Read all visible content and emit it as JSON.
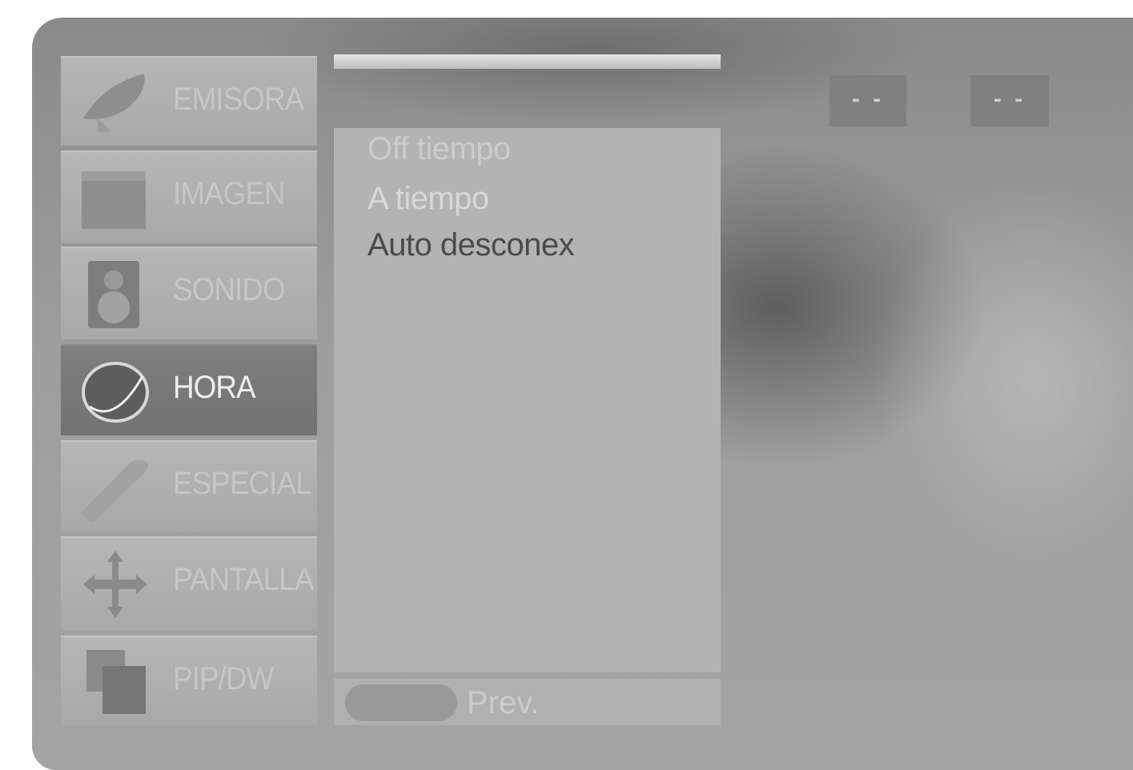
{
  "menu": {
    "items": [
      {
        "label": "EMISORA",
        "icon": "satellite-icon",
        "active": false
      },
      {
        "label": "IMAGEN",
        "icon": "picture-icon",
        "active": false
      },
      {
        "label": "SONIDO",
        "icon": "speaker-icon",
        "active": false
      },
      {
        "label": "HORA",
        "icon": "clock-icon",
        "active": true
      },
      {
        "label": "ESPECIAL",
        "icon": "tool-icon",
        "active": false
      },
      {
        "label": "PANTALLA",
        "icon": "move-arrows-icon",
        "active": false
      },
      {
        "label": "PIP/DW",
        "icon": "pip-windows-icon",
        "active": false
      }
    ]
  },
  "panel": {
    "options": [
      {
        "label": "Off tiempo",
        "color": "#cbcbcb"
      },
      {
        "label": "A tiempo",
        "color": "#d8d8d8"
      },
      {
        "label": "Auto desconex",
        "color": "#4a4a4a"
      }
    ]
  },
  "footer": {
    "prev_label": "Prev."
  },
  "time": {
    "hours": "- -",
    "minutes": "- -"
  }
}
